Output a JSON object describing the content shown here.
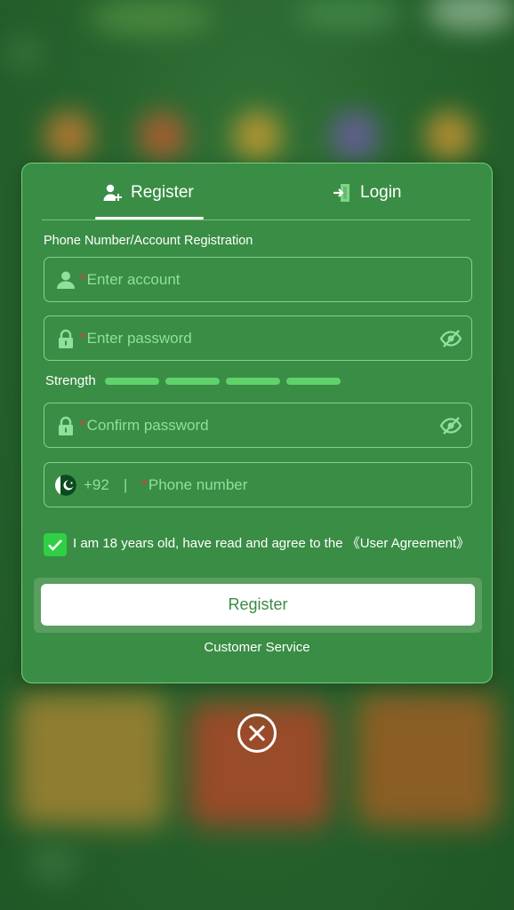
{
  "tabs": {
    "register_label": "Register",
    "login_label": "Login"
  },
  "form": {
    "section_title": "Phone Number/Account Registration",
    "required_mark": "*",
    "account_placeholder": "Enter account",
    "password_placeholder": "Enter password",
    "strength_label": "Strength",
    "confirm_placeholder": "Confirm password",
    "country_code": "+92",
    "separator": "|",
    "phone_placeholder": "Phone number"
  },
  "agreement": {
    "checked": true,
    "text": "I am 18 years old, have read and agree to the",
    "link": "《User Agreement》"
  },
  "register_button_label": "Register",
  "customer_service_label": "Customer Service",
  "icons": [
    "add-user-icon",
    "login-door-icon",
    "user-icon",
    "lock-icon",
    "eye-off-icon",
    "pakistan-flag-icon",
    "checkmark-icon",
    "close-icon"
  ],
  "colors": {
    "modal_bg": "#3a8d45",
    "field_border": "#7ed587",
    "placeholder": "#8fe09a",
    "required": "#e53935",
    "strength_bar": "#5fd36a",
    "checkbox": "#2fd045",
    "button_text": "#3b8a44"
  }
}
